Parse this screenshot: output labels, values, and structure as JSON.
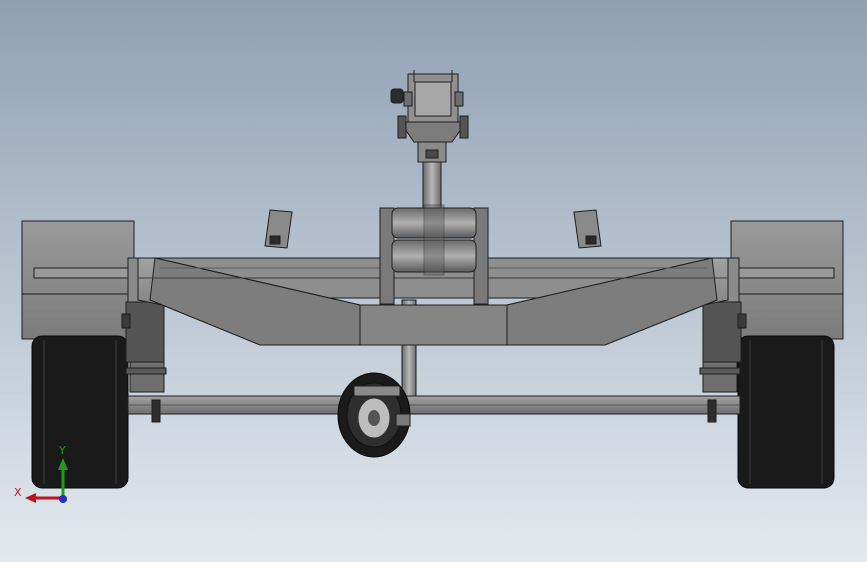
{
  "view": {
    "background_top": "#8fa0b3",
    "background_bottom": "#e4e9ef"
  },
  "triad": {
    "x_label": "X",
    "y_label": "Y",
    "x_color": "#c1121f",
    "y_color": "#1f9a1f",
    "z_color": "#1f2fd0"
  },
  "model": {
    "body_color": "#8c8c8c",
    "dark_color": "#5a5a5a",
    "tire_color": "#1a1a1a",
    "edge_color": "#1e1e1e"
  }
}
